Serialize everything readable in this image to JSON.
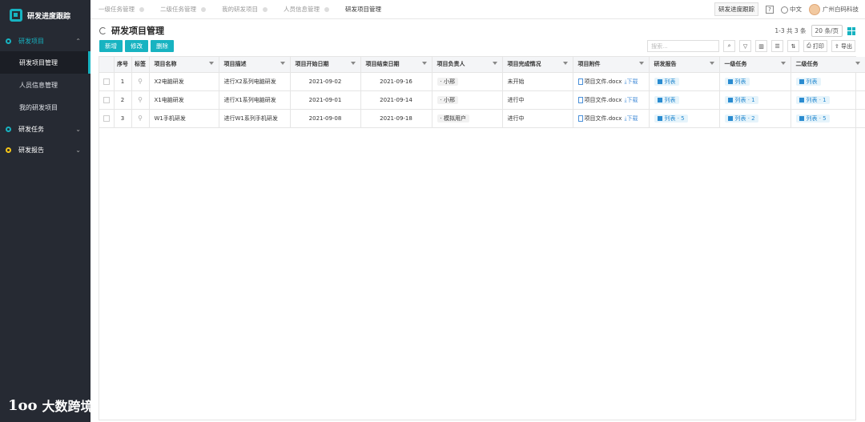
{
  "sidebar": {
    "app_title": "研发进度跟踪",
    "groups": [
      {
        "label": "研发项目",
        "items": [
          "研发项目管理",
          "人员信息管理",
          "我的研发项目"
        ]
      },
      {
        "label": "研发任务"
      },
      {
        "label": "研发报告"
      }
    ]
  },
  "tabs": [
    "一级任务管理",
    "二级任务管理",
    "我的研发项目",
    "人员信息管理",
    "研发项目管理"
  ],
  "topbar": {
    "track_button": "研发进度跟踪",
    "help": "?",
    "language": "中文",
    "company": "广州白码科技"
  },
  "page": {
    "title": "研发项目管理",
    "pagination": "1-3 共 3 条",
    "page_size": "20 条/页",
    "buttons": {
      "add": "新增",
      "edit": "修改",
      "delete": "删除"
    },
    "search_placeholder": "搜索...",
    "print": "打印",
    "export": "导出"
  },
  "table": {
    "headers": [
      "序号",
      "标签",
      "项目名称",
      "项目描述",
      "项目开始日期",
      "项目结束日期",
      "项目负责人",
      "项目完成情况",
      "项目附件",
      "研发报告",
      "一级任务",
      "二级任务"
    ],
    "rows": [
      {
        "no": "1",
        "name": "X2电脑研发",
        "desc": "进行X2系列电脑研发",
        "start": "2021-09-02",
        "end": "2021-09-16",
        "owner": "小邢",
        "status": "未开始",
        "file": "项目文件.docx",
        "download": "下载",
        "report": "列表",
        "task1": "列表",
        "task2": "列表"
      },
      {
        "no": "2",
        "name": "X1电脑研发",
        "desc": "进行X1系列电脑研发",
        "start": "2021-09-01",
        "end": "2021-09-14",
        "owner": "小邢",
        "status": "进行中",
        "file": "项目文件.docx",
        "download": "下载",
        "report": "列表",
        "task1": "列表 · 1",
        "task2": "列表 · 1"
      },
      {
        "no": "3",
        "name": "W1手机研发",
        "desc": "进行W1系列手机研发",
        "start": "2021-09-08",
        "end": "2021-09-18",
        "owner": "模拟用户",
        "status": "进行中",
        "file": "项目文件.docx",
        "download": "下载",
        "report": "列表 · 5",
        "task1": "列表 · 2",
        "task2": "列表 · 5"
      }
    ]
  },
  "watermark": {
    "logo": "1oo",
    "text": "大数跨境"
  },
  "colors": {
    "accent": "#17b3c1",
    "sidebar": "#262a33",
    "link": "#2a8bd0"
  }
}
